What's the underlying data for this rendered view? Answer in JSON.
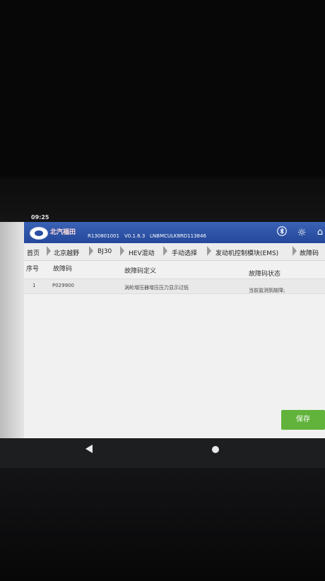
{
  "status_bar": {
    "time": "09:25"
  },
  "header": {
    "brand": "北汽福田",
    "serial": "R130801001",
    "version": "V0.1.6.3",
    "vin": "LNBMCULK8RD113846",
    "icons": [
      "bluetooth-icon",
      "sun-icon",
      "home-icon"
    ]
  },
  "breadcrumb": {
    "items": [
      "首页",
      "北京越野",
      "BJ30",
      "HEV混动",
      "手动选择",
      "发动机控制模块(EMS)",
      "故障码"
    ]
  },
  "table": {
    "columns": [
      "序号",
      "故障码",
      "故障码定义",
      "故障码状态"
    ],
    "rows": [
      {
        "index": "1",
        "code": "P029900",
        "definition": "涡轮增压器增压压力显示过低",
        "status": "当前监测到故障;"
      }
    ]
  },
  "actions": {
    "save_label": "保存"
  },
  "colors": {
    "header": "#2b4fa3",
    "save_button": "#61b33b",
    "row_bg": "#e9e9e9"
  }
}
